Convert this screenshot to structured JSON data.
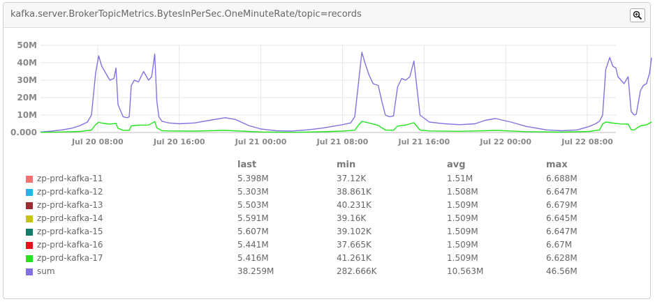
{
  "panel": {
    "title": "kafka.server.BrokerTopicMetrics.BytesInPerSec.OneMinuteRate/topic=records",
    "zoom_icon": "zoom-in-icon"
  },
  "legend": {
    "columns": [
      "last",
      "min",
      "avg",
      "max"
    ],
    "rows": [
      {
        "name": "zp-prd-kafka-11",
        "color": "#f2706d",
        "last": "5.398M",
        "min": "37.12K",
        "avg": "1.51M",
        "max": "6.688M"
      },
      {
        "name": "zp-prd-kafka-12",
        "color": "#1bb8e8",
        "last": "5.303M",
        "min": "38.861K",
        "avg": "1.508M",
        "max": "6.647M"
      },
      {
        "name": "zp-prd-kafka-13",
        "color": "#9b2c2f",
        "last": "5.503M",
        "min": "40.231K",
        "avg": "1.509M",
        "max": "6.679M"
      },
      {
        "name": "zp-prd-kafka-14",
        "color": "#c9c40b",
        "last": "5.591M",
        "min": "39.16K",
        "avg": "1.509M",
        "max": "6.645M"
      },
      {
        "name": "zp-prd-kafka-15",
        "color": "#137d6a",
        "last": "5.607M",
        "min": "39.102K",
        "avg": "1.509M",
        "max": "6.647M"
      },
      {
        "name": "zp-prd-kafka-16",
        "color": "#e8141b",
        "last": "5.441M",
        "min": "37.665K",
        "avg": "1.509M",
        "max": "6.67M"
      },
      {
        "name": "zp-prd-kafka-17",
        "color": "#22e51e",
        "last": "5.416M",
        "min": "41.261K",
        "avg": "1.509M",
        "max": "6.628M"
      },
      {
        "name": "sum",
        "color": "#8470e0",
        "last": "38.259M",
        "min": "282.666K",
        "avg": "10.563M",
        "max": "46.56M"
      }
    ]
  },
  "chart_data": {
    "type": "line",
    "title": "kafka.server.BrokerTopicMetrics.BytesInPerSec.OneMinuteRate/topic=records",
    "xlabel": "",
    "ylabel": "",
    "x_unit": "hours since Jul 20 00:00",
    "xlim": [
      2.4,
      58.8
    ],
    "ylim": [
      0,
      50
    ],
    "y_unit": "M",
    "yticks": [
      0,
      10,
      20,
      30,
      40,
      50
    ],
    "ytick_labels": [
      "0.000",
      "10M",
      "20M",
      "30M",
      "40M",
      "50M"
    ],
    "xticks": [
      8,
      16,
      24,
      32,
      40,
      48,
      56
    ],
    "xtick_labels": [
      "Jul 20 08:00",
      "Jul 20 16:00",
      "Jul 21 00:00",
      "Jul 21 08:00",
      "Jul 21 16:00",
      "Jul 22 00:00",
      "Jul 22 08:00"
    ],
    "grid": true,
    "legend_position": "bottom",
    "series": [
      {
        "name": "sum",
        "color": "#8470e0",
        "x": [
          2.4,
          3.5,
          4.5,
          5.5,
          6.3,
          7.0,
          7.4,
          7.8,
          8.1,
          8.4,
          8.8,
          9.2,
          9.6,
          9.8,
          10.0,
          10.5,
          10.9,
          11.1,
          11.3,
          11.6,
          12.0,
          12.5,
          13.0,
          13.3,
          13.6,
          13.8,
          14.0,
          14.3,
          14.6,
          15.0,
          16.0,
          17.5,
          19.0,
          20.5,
          21.5,
          22.8,
          24.0,
          25.5,
          27.0,
          28.5,
          30.0,
          31.0,
          32.0,
          32.8,
          33.2,
          33.6,
          33.9,
          34.2,
          34.6,
          35.0,
          35.5,
          35.9,
          36.2,
          36.6,
          37.0,
          37.4,
          37.8,
          38.2,
          38.6,
          39.0,
          39.6,
          40.5,
          42.0,
          43.5,
          45.0,
          46.0,
          47.0,
          48.5,
          50.0,
          52.0,
          53.5,
          55.0,
          56.2,
          56.8,
          57.2,
          57.5,
          57.8,
          58.2,
          58.5,
          58.8,
          59.0,
          59.3,
          59.6,
          60.0,
          60.3,
          60.6,
          60.8,
          61.2,
          61.5,
          61.8,
          62.1,
          62.3
        ],
        "y": [
          0.3,
          0.8,
          1.5,
          2.5,
          4.0,
          6.0,
          10.0,
          34.0,
          44.0,
          38.0,
          34.0,
          30.0,
          31.0,
          37.0,
          16.0,
          9.0,
          8.5,
          9.0,
          27.0,
          30.0,
          29.0,
          35.0,
          30.0,
          32.0,
          45.0,
          18.0,
          9.0,
          6.5,
          6.0,
          5.5,
          5.0,
          5.5,
          7.0,
          8.5,
          7.5,
          4.0,
          2.0,
          1.0,
          0.8,
          1.5,
          2.5,
          3.5,
          4.5,
          5.5,
          9.0,
          30.0,
          46.0,
          40.0,
          33.0,
          28.0,
          27.0,
          17.0,
          10.0,
          9.0,
          9.5,
          26.0,
          31.0,
          30.0,
          32.0,
          41.0,
          10.0,
          6.0,
          5.0,
          4.5,
          5.0,
          7.0,
          8.0,
          6.0,
          3.5,
          1.5,
          1.0,
          1.5,
          3.5,
          5.0,
          6.5,
          10.0,
          36.0,
          43.0,
          38.0,
          37.0,
          32.0,
          30.0,
          28.0,
          32.0,
          12.0,
          10.0,
          10.5,
          24.0,
          27.0,
          28.0,
          34.0,
          43.0
        ]
      },
      {
        "name": "zp-prd-kafka-17",
        "color": "#22e51e",
        "x": [
          2.4,
          4.5,
          6.3,
          7.4,
          7.8,
          8.1,
          8.4,
          9.2,
          9.8,
          10.0,
          10.5,
          11.1,
          11.3,
          12.0,
          13.0,
          13.6,
          13.8,
          14.3,
          15.0,
          17.5,
          20.5,
          22.8,
          24.0,
          27.0,
          30.0,
          32.0,
          33.2,
          33.6,
          33.9,
          34.6,
          35.5,
          36.2,
          37.0,
          37.4,
          38.2,
          39.0,
          39.6,
          40.5,
          43.5,
          46.0,
          47.0,
          50.0,
          53.5,
          56.2,
          57.2,
          57.5,
          57.8,
          58.5,
          59.3,
          60.0,
          60.3,
          60.6,
          61.2,
          61.8,
          62.3
        ],
        "y": [
          0.1,
          0.3,
          0.6,
          1.4,
          4.5,
          5.9,
          5.4,
          4.8,
          5.2,
          2.4,
          1.3,
          1.2,
          3.8,
          4.2,
          4.3,
          6.3,
          2.6,
          1.0,
          0.9,
          0.8,
          1.2,
          0.6,
          0.3,
          0.1,
          0.4,
          0.8,
          1.3,
          4.4,
          6.4,
          5.5,
          4.1,
          1.4,
          1.3,
          3.7,
          4.3,
          5.6,
          1.4,
          0.9,
          0.7,
          1.0,
          1.2,
          0.5,
          0.2,
          0.6,
          1.5,
          4.9,
          6.0,
          5.4,
          4.9,
          4.8,
          1.6,
          1.5,
          3.8,
          4.4,
          6.0
        ]
      }
    ]
  }
}
